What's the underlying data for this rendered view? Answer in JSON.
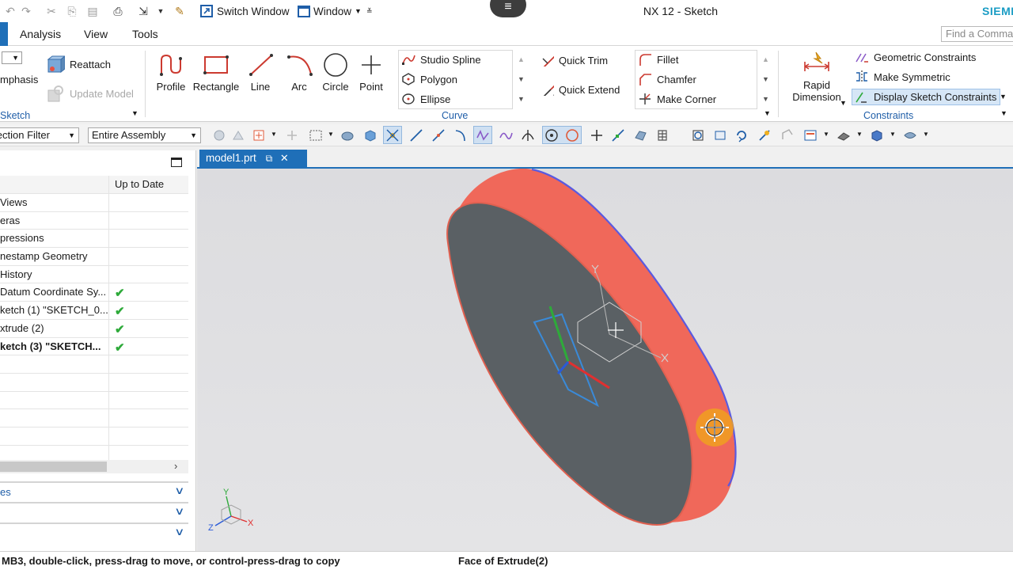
{
  "app": {
    "title": "NX 12 - Sketch",
    "brand": "SIEMENS",
    "switch_window": "Switch Window",
    "window_menu": "Window"
  },
  "tabs": [
    "Analysis",
    "View",
    "Tools"
  ],
  "find_command_placeholder": "Find a Command",
  "ribbon": {
    "left_group": {
      "emphasis": "mphasis",
      "reattach": "Reattach",
      "update_model": "Update Model",
      "label": "Sketch"
    },
    "curve_tools": [
      "Profile",
      "Rectangle",
      "Line",
      "Arc",
      "Circle",
      "Point"
    ],
    "curve_list": [
      "Studio Spline",
      "Polygon",
      "Ellipse"
    ],
    "trim": [
      "Quick Trim",
      "Quick Extend"
    ],
    "corner_list": [
      "Fillet",
      "Chamfer",
      "Make Corner"
    ],
    "curve_label": "Curve",
    "rapid_dimension": [
      "Rapid",
      "Dimension"
    ],
    "constraints_list": [
      "Geometric Constraints",
      "Make Symmetric",
      "Display Sketch Constraints"
    ],
    "constraints_label": "Constraints"
  },
  "selection": {
    "filter": "Selection Filter",
    "scope": "Entire Assembly"
  },
  "navigator": {
    "column_status": "Up to Date",
    "rows": [
      {
        "name": "Views",
        "ok": false,
        "bold": false
      },
      {
        "name": "eras",
        "ok": false,
        "bold": false
      },
      {
        "name": "pressions",
        "ok": false,
        "bold": false
      },
      {
        "name": "nestamp Geometry",
        "ok": false,
        "bold": false
      },
      {
        "name": "History",
        "ok": false,
        "bold": false
      },
      {
        "name": "Datum Coordinate Sy...",
        "ok": true,
        "bold": false
      },
      {
        "name": "ketch (1) \"SKETCH_0...",
        "ok": true,
        "bold": false
      },
      {
        "name": "xtrude (2)",
        "ok": true,
        "bold": false
      },
      {
        "name": "ketch (3) \"SKETCH...",
        "ok": true,
        "bold": true
      },
      {
        "name": "",
        "ok": false,
        "bold": false
      },
      {
        "name": "",
        "ok": false,
        "bold": false
      },
      {
        "name": "",
        "ok": false,
        "bold": false
      },
      {
        "name": "",
        "ok": false,
        "bold": false
      },
      {
        "name": "",
        "ok": false,
        "bold": false
      },
      {
        "name": "",
        "ok": false,
        "bold": false
      }
    ],
    "sections": [
      "es",
      "",
      ""
    ]
  },
  "graphics_tab": "model1.prt",
  "triad_labels": {
    "x": "X",
    "y": "Y",
    "z": "Z"
  },
  "status": {
    "left": "MB3, double-click, press-drag to move, or control-press-drag to copy",
    "right": "Face of Extrude(2)"
  },
  "colors": {
    "accent": "#1f6fb8",
    "extrude_side": "#f0685a",
    "extrude_face": "#5a6064",
    "sketch_blue": "#3a8ad8",
    "check_green": "#2eaa3a"
  }
}
